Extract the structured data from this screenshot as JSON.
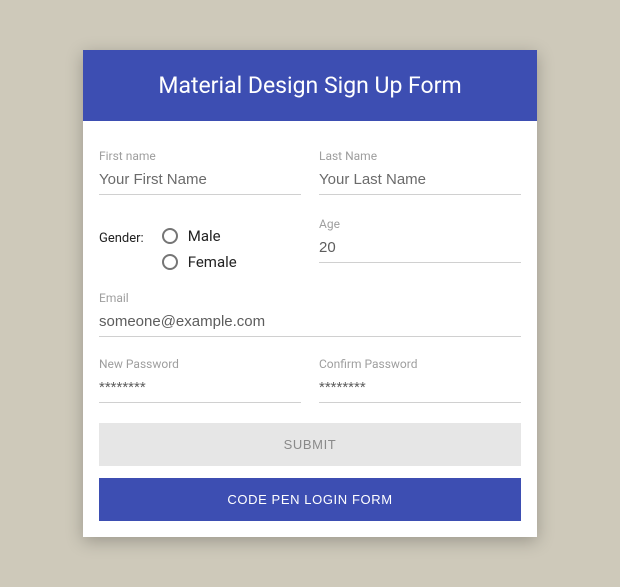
{
  "header": {
    "title": "Material Design Sign Up Form"
  },
  "firstName": {
    "label": "First name",
    "placeholder": "Your First Name",
    "value": ""
  },
  "lastName": {
    "label": "Last Name",
    "placeholder": "Your Last Name",
    "value": ""
  },
  "gender": {
    "label": "Gender:",
    "options": {
      "male": "Male",
      "female": "Female"
    }
  },
  "age": {
    "label": "Age",
    "value": "20"
  },
  "email": {
    "label": "Email",
    "value": "someone@example.com"
  },
  "newPassword": {
    "label": "New Password",
    "value": "********"
  },
  "confirmPassword": {
    "label": "Confirm Password",
    "value": "********"
  },
  "buttons": {
    "submit": "SUBMIT",
    "codepenLogin": "CODE PEN LOGIN FORM"
  }
}
